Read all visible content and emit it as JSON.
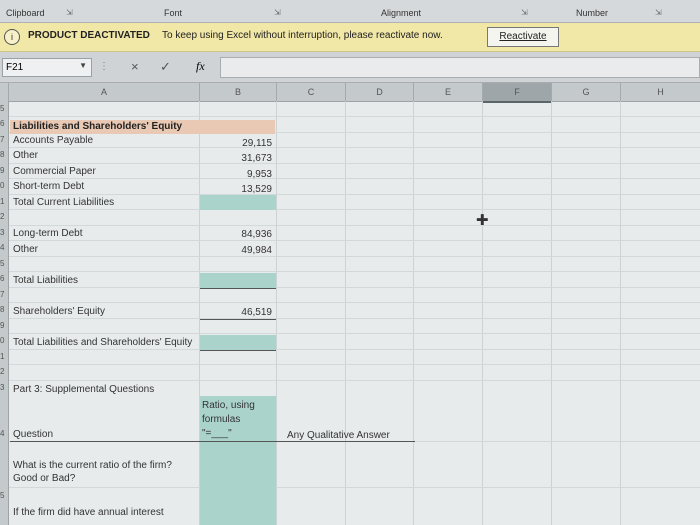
{
  "ribbon": {
    "groups": [
      "Clipboard",
      "Font",
      "Alignment",
      "Number"
    ]
  },
  "banner": {
    "title": "PRODUCT DEACTIVATED",
    "message": "To keep using Excel without interruption, please reactivate now.",
    "button": "Reactivate"
  },
  "formula_bar": {
    "name_box": "F21",
    "cancel": "×",
    "enter": "✓",
    "fx": "fx",
    "value": ""
  },
  "columns": [
    "A",
    "B",
    "C",
    "D",
    "E",
    "F",
    "G",
    "H"
  ],
  "selected_column": "F",
  "row_numbers": [
    "5",
    "6",
    "7",
    "8",
    "9",
    "0",
    "1",
    "2",
    "3",
    "4",
    "5",
    "6",
    "7",
    "8",
    "9",
    "0",
    "1",
    "2",
    "3",
    "4",
    "",
    "5"
  ],
  "sheet": {
    "heading": "Liabilities and Shareholders' Equity",
    "accounts_payable": "Accounts Payable",
    "accounts_payable_val": "29,115",
    "other": "Other",
    "other_val": "31,673",
    "commercial_paper": "Commercial Paper",
    "commercial_paper_val": "9,953",
    "short_term_debt": "Short-term Debt",
    "short_term_debt_val": "13,529",
    "total_current": "Total Current Liabilities",
    "long_term_debt": "Long-term Debt",
    "long_term_debt_val": "84,936",
    "other2": "Other",
    "other2_val": "49,984",
    "total_liabilities": "Total Liabilities",
    "shareholders_equity": "Shareholders' Equity",
    "shareholders_equity_val": "46,519",
    "total_liab_se": "Total Liabilities and Shareholders' Equity",
    "part3": "Part 3: Supplemental Questions",
    "ratio_hdr_1": "Ratio, using",
    "ratio_hdr_2": "formulas",
    "ratio_hdr_3": "\"=___\"",
    "question_hdr": "Question",
    "qualitative_hdr": "Any Qualitative Answer",
    "q1_line1": "What is the current ratio of the firm?",
    "q1_line2": "Good or Bad?",
    "q2_line1": "If the firm did have annual interest"
  }
}
